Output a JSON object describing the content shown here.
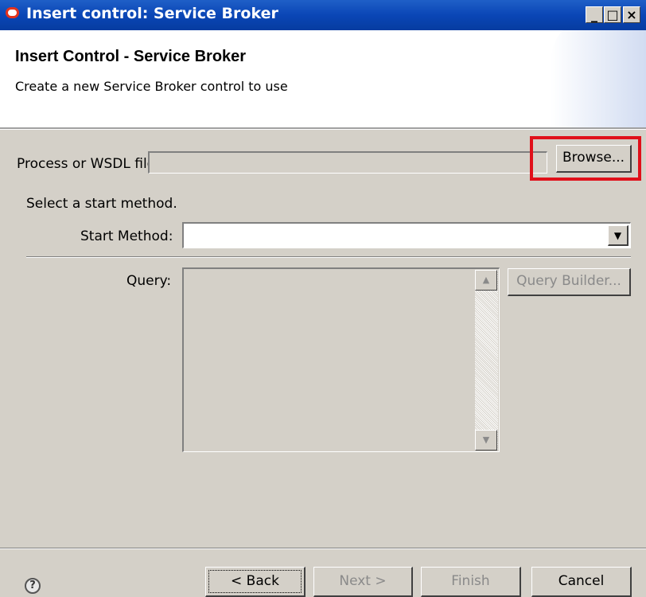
{
  "window": {
    "title": "Insert control: Service Broker",
    "icon": "oracle-logo-icon",
    "controls": [
      "_",
      "□",
      "×"
    ]
  },
  "header": {
    "title": "Insert Control - Service Broker",
    "subtitle": "Create a new Service Broker control to use"
  },
  "form": {
    "wsdl_label": "Process or WSDL file:",
    "wsdl_value": "",
    "browse_label": "Browse...",
    "instruction": "Select a start method.",
    "start_method_label": "Start Method:",
    "start_method_value": "",
    "query_label": "Query:",
    "query_value": "",
    "query_builder_label": "Query Builder..."
  },
  "footer": {
    "help_icon": "help-icon",
    "back_label": "< Back",
    "next_label": "Next >",
    "finish_label": "Finish",
    "cancel_label": "Cancel"
  },
  "colors": {
    "titlebar": "#0a46b6",
    "panel": "#d4d0c8",
    "highlight": "#e0101a"
  }
}
